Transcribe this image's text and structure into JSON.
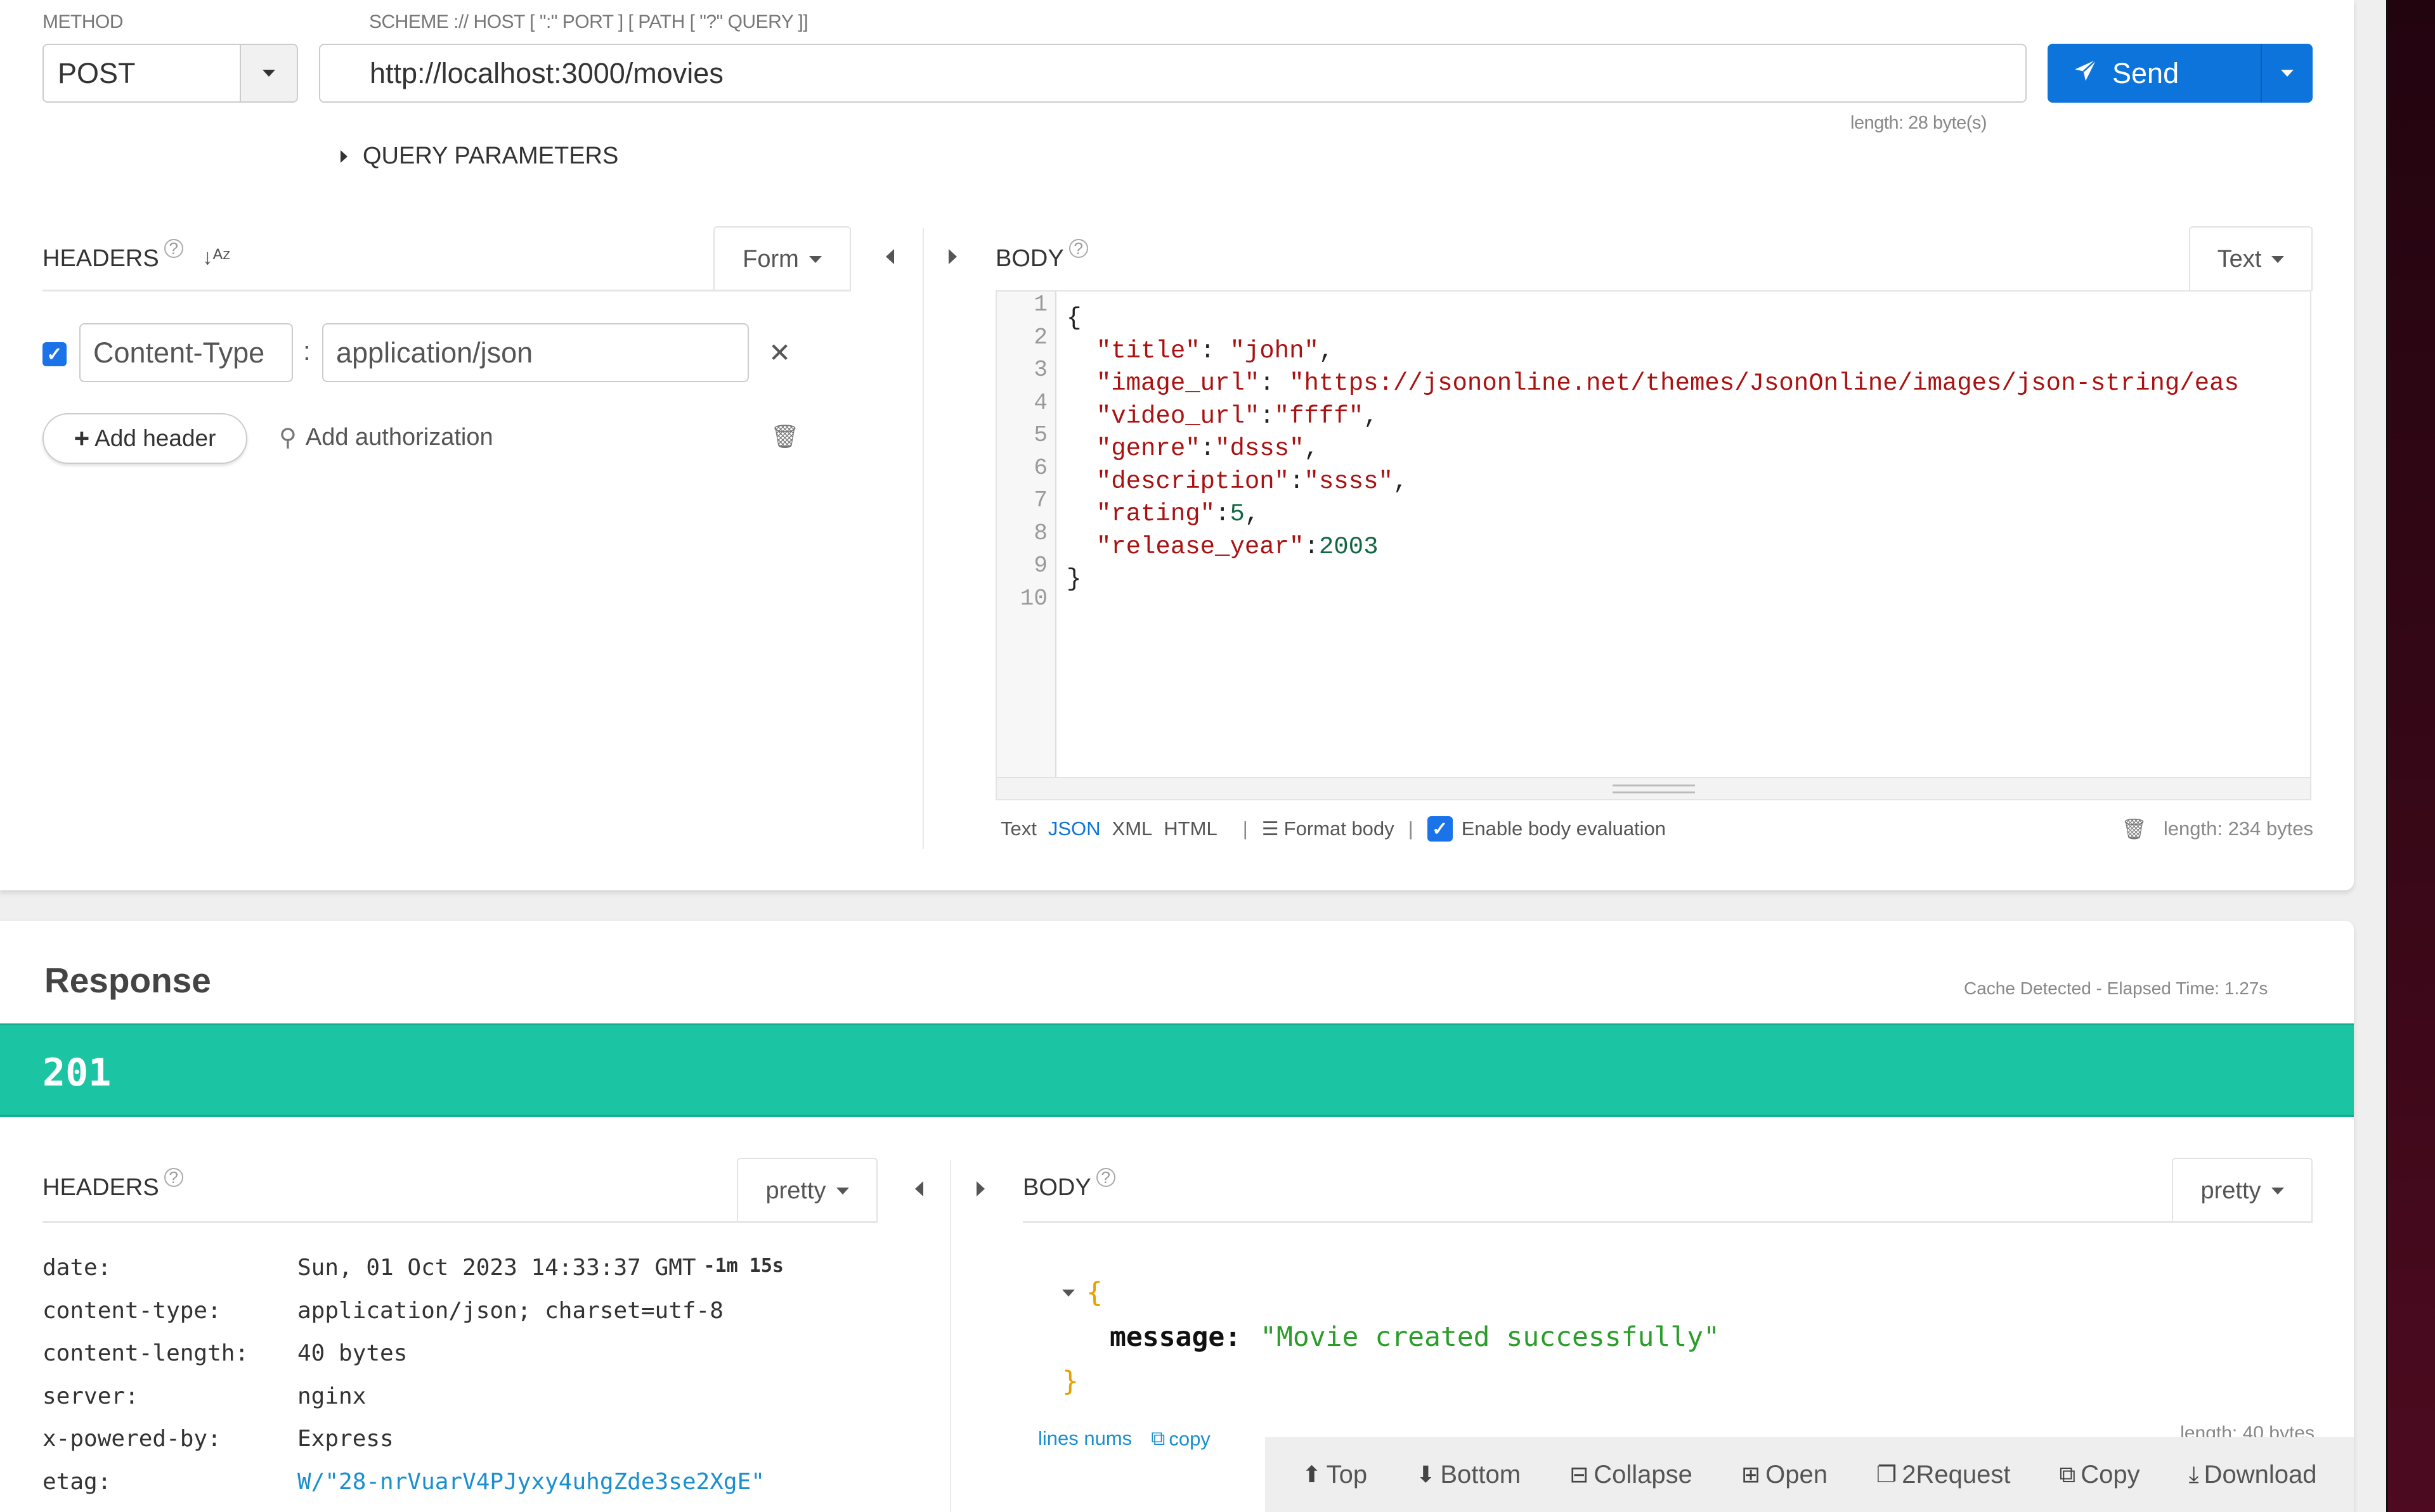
{
  "request": {
    "method_label": "METHOD",
    "method_value": "POST",
    "url_label": "SCHEME :// HOST [ \":\" PORT ] [ PATH [ \"?\" QUERY ]]",
    "url_value": "http://localhost:3000/movies",
    "url_length": "length: 28 byte(s)",
    "send_label": "Send",
    "query_params_label": "QUERY PARAMETERS",
    "headers": {
      "title": "HEADERS",
      "mode": "Form",
      "rows": [
        {
          "enabled": true,
          "name": "Content-Type",
          "value": "application/json"
        }
      ],
      "add_header_label": "Add header",
      "add_auth_label": "Add authorization"
    },
    "body": {
      "title": "BODY",
      "mode": "Text",
      "line_numbers": [
        "1",
        "2",
        "3",
        "4",
        "5",
        "6",
        "7",
        "8",
        "9",
        "10"
      ],
      "code_lines": [
        "{",
        "  \"title\": \"john\",",
        "  \"image_url\": \"https://jsononline.net/themes/JsonOnline/images/json-string/eas",
        "  \"video_url\":\"ffff\",",
        "  \"genre\":\"dsss\",",
        "  \"description\":\"ssss\",",
        "  \"rating\":5,",
        "  \"release_year\":2003",
        "}",
        ""
      ],
      "formats": [
        "Text",
        "JSON",
        "XML",
        "HTML"
      ],
      "selected_format": "JSON",
      "format_body_label": "Format body",
      "enable_eval_label": "Enable body evaluation",
      "enable_eval_checked": true,
      "length": "length: 234 bytes"
    }
  },
  "response": {
    "title": "Response",
    "meta": "Cache Detected - Elapsed Time: 1.27s",
    "status_code": "201",
    "status_color": "#1bc5a3",
    "headers": {
      "title": "HEADERS",
      "mode": "pretty",
      "rows": [
        {
          "key": "date:",
          "value": "Sun, 01 Oct 2023 14:33:37 GMT",
          "age": "-1m 15s"
        },
        {
          "key": "content-type:",
          "value": "application/json; charset=utf-8"
        },
        {
          "key": "content-length:",
          "value": "40 bytes"
        },
        {
          "key": "server:",
          "value": "nginx"
        },
        {
          "key": "x-powered-by:",
          "value": "Express"
        },
        {
          "key": "etag:",
          "value": "W/\"28-nrVuarV4PJyxy4uhgZde3se2XgE\""
        }
      ]
    },
    "body": {
      "title": "BODY",
      "mode": "pretty",
      "open_brace": "{",
      "close_brace": "}",
      "key": "message:",
      "value": "\"Movie created successfully\"",
      "lines_nums_label": "lines nums",
      "copy_label": "copy",
      "length": "length: 40 bytes"
    },
    "toolbar": [
      {
        "icon": "arrow-up-circle-icon",
        "label": "Top"
      },
      {
        "icon": "arrow-down-circle-icon",
        "label": "Bottom"
      },
      {
        "icon": "minus-square-icon",
        "label": "Collapse"
      },
      {
        "icon": "plus-square-icon",
        "label": "Open"
      },
      {
        "icon": "file-copy-icon",
        "label": "2Request"
      },
      {
        "icon": "copy-icon",
        "label": "Copy"
      },
      {
        "icon": "download-icon",
        "label": "Download"
      }
    ]
  },
  "colors": {
    "accent": "#0c74da",
    "success": "#1bc5a3",
    "json_key": "#aa1111",
    "json_number": "#116644",
    "json_string_response": "#2a9d2a"
  }
}
